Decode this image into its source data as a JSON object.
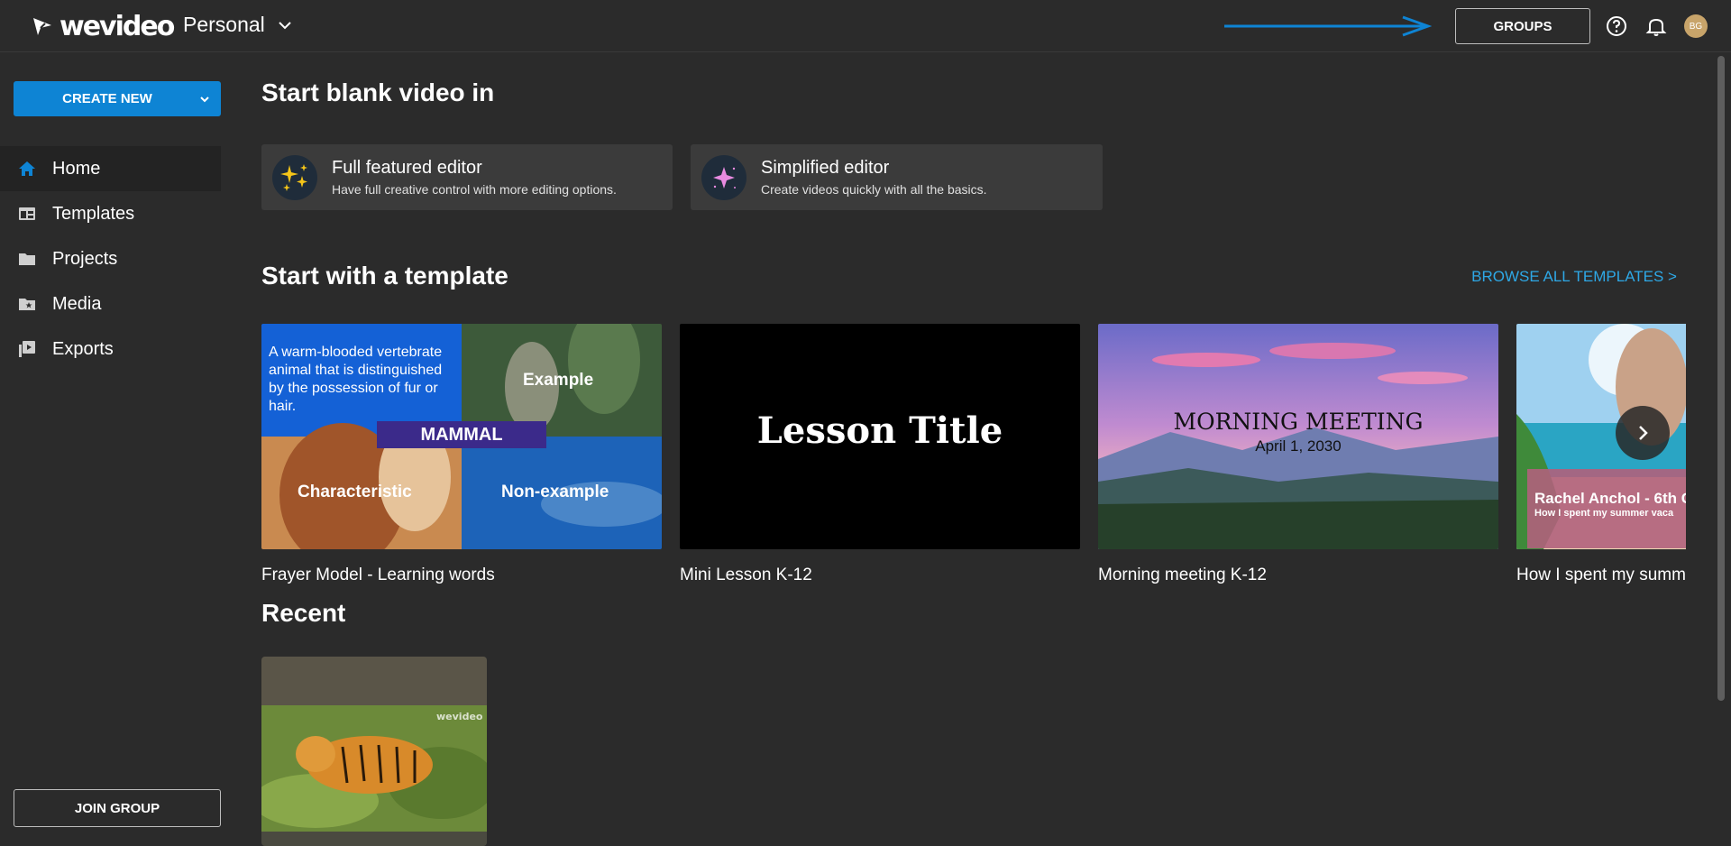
{
  "header": {
    "logo_text": "wevideo",
    "workspace": "Personal",
    "groups_label": "GROUPS",
    "avatar_initials": "BG",
    "accent_arrow_color": "#0e84d4"
  },
  "sidebar": {
    "create_label": "CREATE NEW",
    "items": [
      {
        "label": "Home",
        "icon": "home-icon"
      },
      {
        "label": "Templates",
        "icon": "templates-icon"
      },
      {
        "label": "Projects",
        "icon": "folder-icon"
      },
      {
        "label": "Media",
        "icon": "media-folder-icon"
      },
      {
        "label": "Exports",
        "icon": "exports-icon"
      }
    ],
    "join_label": "JOIN GROUP"
  },
  "main": {
    "blank_heading": "Start blank video in",
    "editors": [
      {
        "title": "Full featured editor",
        "subtitle": "Have full creative control with more editing options."
      },
      {
        "title": "Simplified editor",
        "subtitle": "Create videos quickly with all the basics."
      }
    ],
    "template_heading": "Start with a template",
    "browse_label": "BROWSE ALL TEMPLATES >",
    "templates": [
      {
        "title": "Frayer Model - Learning words",
        "thumb": {
          "definition": "A warm-blooded vertebrate animal that is distinguished by the possession of fur or hair.",
          "word": "MAMMAL",
          "example": "Example",
          "characteristic": "Characteristic",
          "nonexample": "Non-example"
        }
      },
      {
        "title": "Mini Lesson K-12",
        "thumb": {
          "text": "Lesson Title"
        }
      },
      {
        "title": "Morning meeting K-12",
        "thumb": {
          "heading": "MORNING MEETING",
          "date": "April 1, 2030"
        }
      },
      {
        "title": "How I spent my summ",
        "thumb": {
          "name": "Rachel Anchol - 6th G",
          "line": "How I spent my summer vaca"
        }
      }
    ],
    "recent_heading": "Recent",
    "recent_watermark": "wevideo"
  },
  "colors": {
    "background": "#2b2b2b",
    "primary": "#0e84d4",
    "link": "#2ea8e6"
  }
}
